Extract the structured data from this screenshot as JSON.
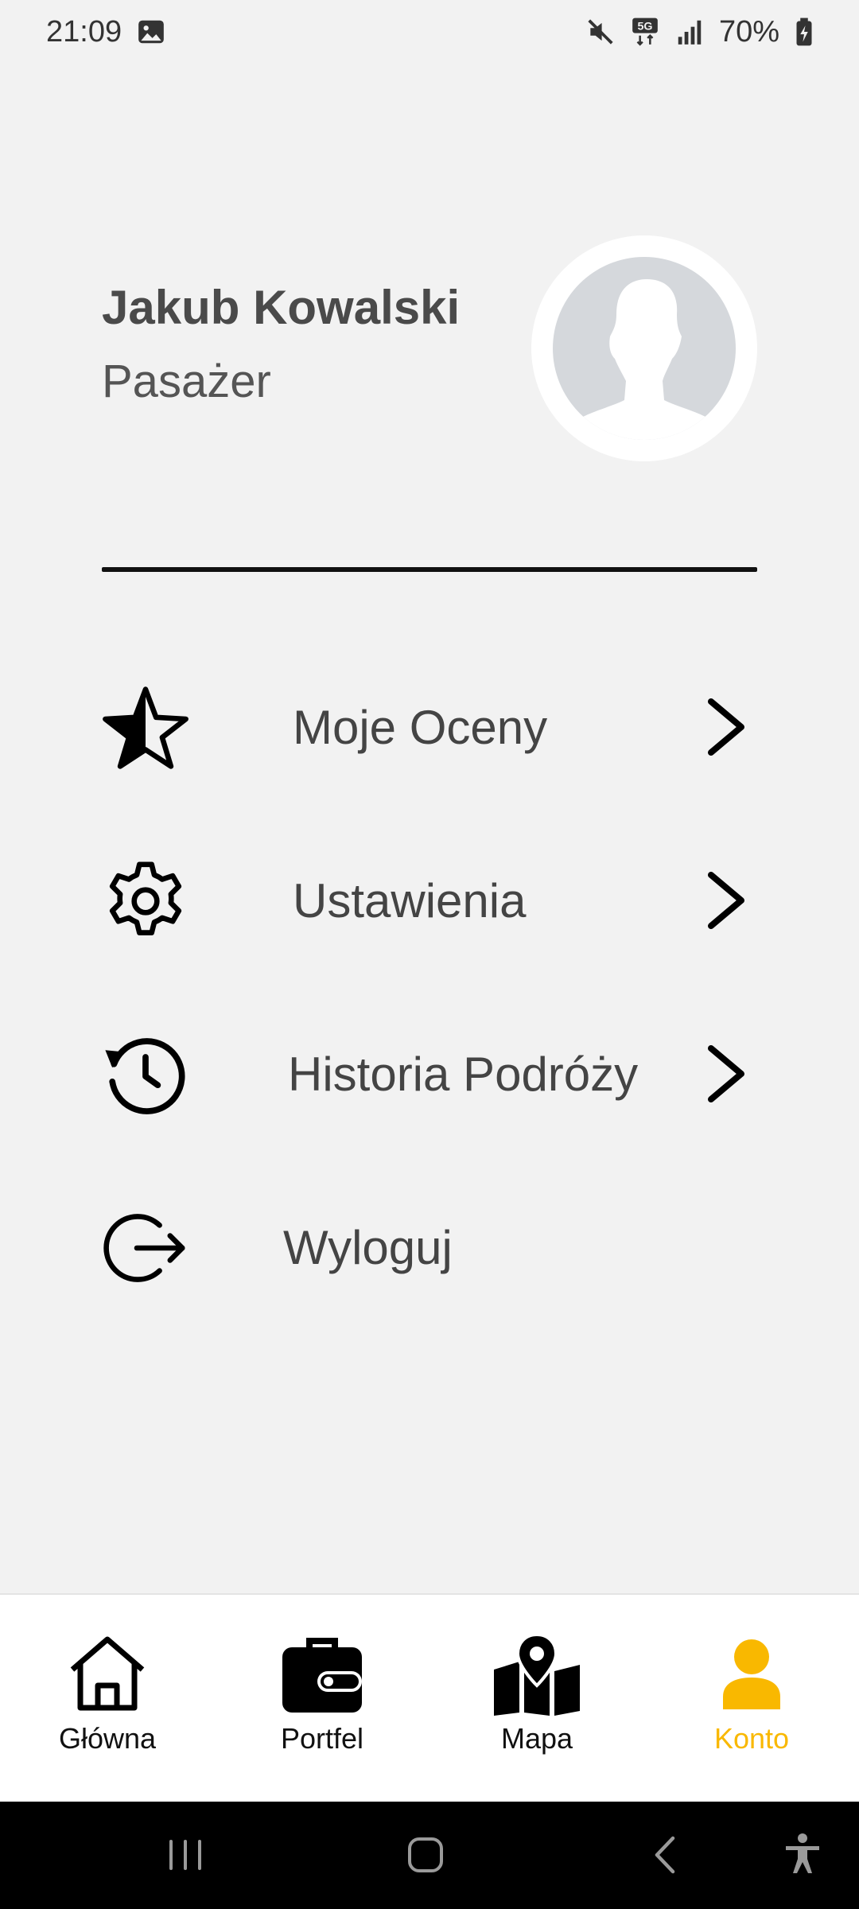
{
  "status_bar": {
    "time": "21:09",
    "battery_percent": "70%",
    "icons": [
      "gallery-icon",
      "mute-icon",
      "5g-icon",
      "signal-icon",
      "battery-icon"
    ]
  },
  "profile": {
    "name": "Jakub Kowalski",
    "role": "Pasażer",
    "avatar_icon": "person-silhouette-icon"
  },
  "menu": {
    "items": [
      {
        "label": "Moje Oceny",
        "icon": "half-star-icon",
        "has_chevron": true
      },
      {
        "label": "Ustawienia",
        "icon": "gear-icon",
        "has_chevron": true
      },
      {
        "label": "Historia Podróży",
        "icon": "history-clock-icon",
        "has_chevron": true
      },
      {
        "label": "Wyloguj",
        "icon": "logout-icon",
        "has_chevron": false
      }
    ]
  },
  "bottom_nav": {
    "active_index": 3,
    "active_color": "#f9b800",
    "items": [
      {
        "label": "Główna",
        "icon": "home-icon"
      },
      {
        "label": "Portfel",
        "icon": "wallet-icon"
      },
      {
        "label": "Mapa",
        "icon": "map-icon"
      },
      {
        "label": "Konto",
        "icon": "account-icon"
      }
    ]
  },
  "system_nav": {
    "buttons": [
      "recents-button",
      "home-button",
      "back-button",
      "accessibility-button"
    ]
  }
}
